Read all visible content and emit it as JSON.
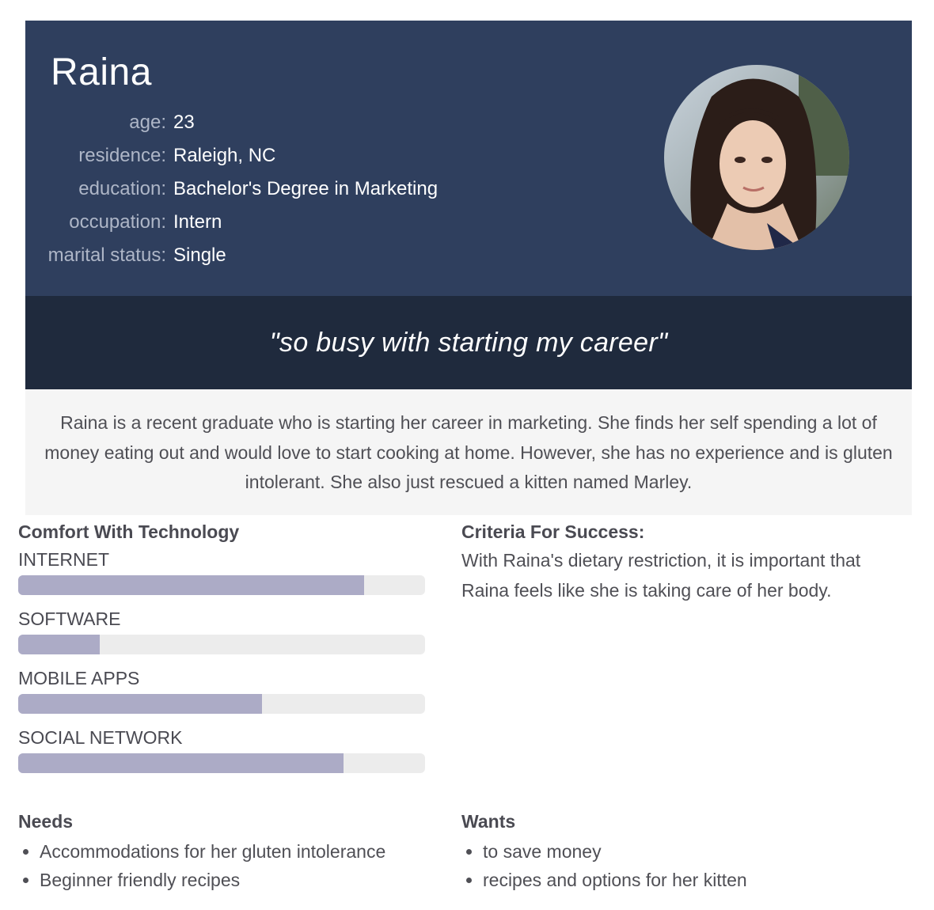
{
  "persona": {
    "name": "Raina",
    "facts": [
      {
        "label": "age:",
        "value": "23"
      },
      {
        "label": "residence:",
        "value": "Raleigh, NC"
      },
      {
        "label": "education:",
        "value": "Bachelor's Degree in Marketing"
      },
      {
        "label": "occupation:",
        "value": "Intern"
      },
      {
        "label": "marital status:",
        "value": "Single"
      }
    ],
    "avatar_icon": "portrait-photo",
    "quote": "\"so busy with starting my career\"",
    "bio": "Raina is a recent graduate who is starting her career in marketing. She finds her self spending a lot of money eating out and would love to start cooking at home. However, she has no experience and is gluten intolerant. She also just rescued a kitten named Marley."
  },
  "comfort": {
    "title": "Comfort With Technology",
    "skills": [
      {
        "label": "INTERNET",
        "level": 0.85
      },
      {
        "label": "SOFTWARE",
        "level": 0.2
      },
      {
        "label": "MOBILE APPS",
        "level": 0.6
      },
      {
        "label": "SOCIAL NETWORK",
        "level": 0.8
      }
    ]
  },
  "criteria": {
    "title": "Criteria For Success:",
    "text": "With Raina's dietary restriction, it is important that Raina feels like she is taking care of her body."
  },
  "needs": {
    "title": "Needs",
    "items": [
      "Accommodations for her gluten intolerance",
      "Beginner friendly recipes"
    ]
  },
  "wants": {
    "title": "Wants",
    "items": [
      "to save money",
      "recipes and options for her kitten"
    ]
  },
  "colors": {
    "header_bg": "#2f3f5e",
    "quote_bg": "#1f2a3d",
    "bar_fill": "#acabc6",
    "bar_track": "#ececec"
  }
}
